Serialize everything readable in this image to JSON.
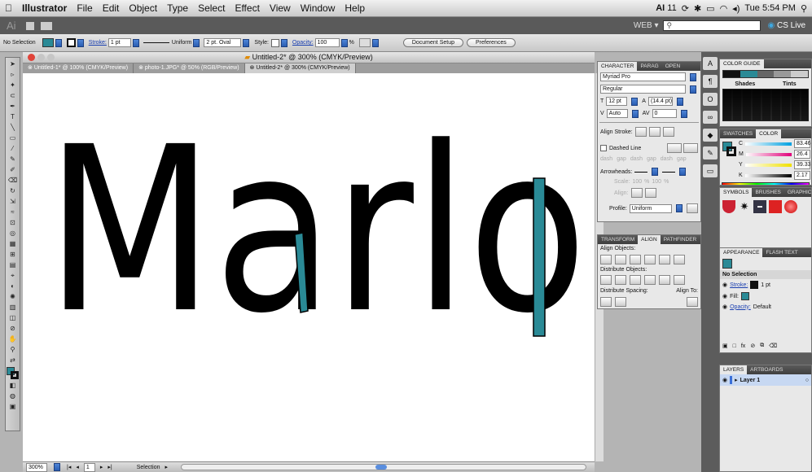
{
  "menubar": {
    "apple": "",
    "items": [
      "Illustrator",
      "File",
      "Edit",
      "Object",
      "Type",
      "Select",
      "Effect",
      "View",
      "Window",
      "Help"
    ],
    "ai_badge": "AI",
    "ai_num": "11",
    "clock": "Tue 5:54 PM"
  },
  "appbar": {
    "logo": "Ai",
    "workspace": "WEB ▾",
    "search_placeholder": "",
    "cslive": "CS Live"
  },
  "control": {
    "selection": "No Selection",
    "stroke_label": "Stroke:",
    "stroke_value": "1 pt",
    "profile": "Uniform",
    "brush": "2 pt. Oval",
    "style_label": "Style:",
    "opacity_label": "Opacity:",
    "opacity_value": "100",
    "pct": "%",
    "doc_setup": "Document Setup",
    "preferences": "Preferences",
    "fill_color": "#2a8a96"
  },
  "document": {
    "title": "Untitled-2* @ 300% (CMYK/Preview)",
    "tabs": [
      "Untitled-1* @ 100% (CMYK/Preview)",
      "photo-1.JPG* @ 50% (RGB/Preview)",
      "Untitled-2* @ 300% (CMYK/Preview)"
    ],
    "active_tab": 2,
    "artwork_text": "Marlo",
    "accent": "#2a8a96"
  },
  "status": {
    "zoom": "300%",
    "page": "1",
    "tool": "Selection"
  },
  "character": {
    "tabs": [
      "CHARACTER",
      "PARAG",
      "OPEN"
    ],
    "font": "Myriad Pro",
    "style": "Regular",
    "size": "12 pt",
    "leading": "(14.4 pt)",
    "kern": "Auto",
    "tracking": "0"
  },
  "stroke_panel": {
    "align_stroke": "Align Stroke:",
    "dashed": "Dashed Line",
    "dash_labels": [
      "dash",
      "gap",
      "dash",
      "gap",
      "dash",
      "gap"
    ],
    "arrowheads": "Arrowheads:",
    "scale": "Scale:",
    "scale_a": "100",
    "scale_b": "100",
    "pct": "%",
    "align": "Align:",
    "profile_label": "Profile:",
    "profile_value": "Uniform"
  },
  "align_panel": {
    "tabs": [
      "TRANSFORM",
      "ALIGN",
      "PATHFINDER"
    ],
    "align_objects": "Align Objects:",
    "distribute_objects": "Distribute Objects:",
    "distribute_spacing": "Distribute Spacing:",
    "align_to": "Align To:"
  },
  "color_guide": {
    "title": "COLOR GUIDE",
    "shades": "Shades",
    "tints": "Tints"
  },
  "color_panel": {
    "tabs": [
      "SWATCHES",
      "COLOR"
    ],
    "channels": [
      {
        "k": "C",
        "v": "83.46"
      },
      {
        "k": "M",
        "v": "26.4"
      },
      {
        "k": "Y",
        "v": "39.33"
      },
      {
        "k": "K",
        "v": "2.17"
      }
    ]
  },
  "symbols_tabs": [
    "SYMBOLS",
    "BRUSHES",
    "GRAPHIC STYLE"
  ],
  "appearance": {
    "tabs": [
      "APPEARANCE",
      "FLASH TEXT"
    ],
    "selection": "No Selection",
    "stroke": "Stroke:",
    "stroke_val": "1 pt",
    "fill": "Fill:",
    "opacity": "Opacity:",
    "opacity_val": "Default"
  },
  "layers": {
    "tabs": [
      "LAYERS",
      "ARTBOARDS"
    ],
    "layer": "Layer 1"
  }
}
